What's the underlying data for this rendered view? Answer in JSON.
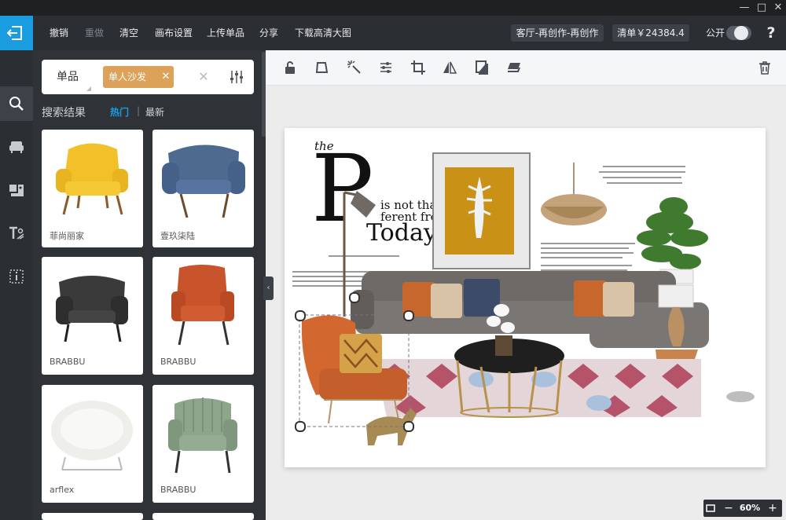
{
  "window": {
    "minimize": "—",
    "maximize": "□",
    "close": "✕"
  },
  "toolbar": {
    "undo": "撤销",
    "redo": "重做",
    "clear": "清空",
    "canvas_settings": "画布设置",
    "upload": "上传单品",
    "share": "分享",
    "download": "下载高清大图",
    "project_title": "客厅-再创作-再创作",
    "list_total": "清单￥24384.4",
    "public_label": "公开",
    "help": "?"
  },
  "sidebar_rail": {
    "icons": [
      "search-icon",
      "sofa-icon",
      "material-icon",
      "text-icon",
      "info-icon"
    ]
  },
  "search": {
    "category": "单品",
    "tag": "单人沙发",
    "results_title": "搜索结果",
    "tab_hot": "热门",
    "tab_separator": "|",
    "tab_new": "最新"
  },
  "results": [
    {
      "label": "菲尚丽家"
    },
    {
      "label": "壹玖柒陆"
    },
    {
      "label": "BRABBU"
    },
    {
      "label": "BRABBU"
    },
    {
      "label": "arflex"
    },
    {
      "label": "BRABBU"
    }
  ],
  "zoom": {
    "level": "60%",
    "minus": "−",
    "plus": "+"
  },
  "canvas_text": {
    "the": "the",
    "p": "P",
    "line1": "is not that",
    "line2": "ferent from",
    "today": "Today"
  },
  "colors": {
    "accent": "#1a9ce0",
    "tag": "#dca25a",
    "toolbar": "#2b2e33"
  }
}
